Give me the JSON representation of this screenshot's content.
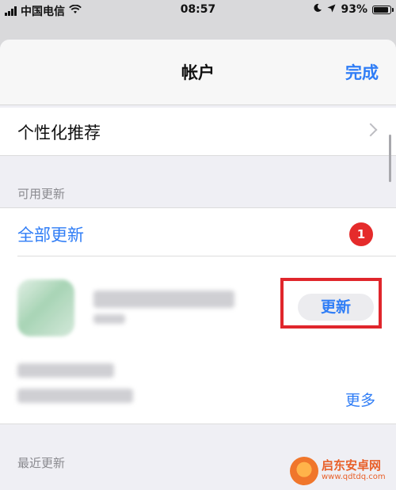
{
  "status_bar": {
    "carrier": "中国电信",
    "time": "08:57",
    "battery": "93%",
    "battery_level": 0.93
  },
  "nav": {
    "title": "帐户",
    "done_label": "完成"
  },
  "personalization": {
    "label": "个性化推荐"
  },
  "available_updates": {
    "section_title": "可用更新",
    "update_all_label": "全部更新",
    "badge_count": "1",
    "app": {
      "update_button_label": "更新",
      "more_label": "更多"
    }
  },
  "recent_updates": {
    "section_title": "最近更新"
  },
  "watermark": {
    "title": "启东安卓网",
    "url": "www.qdtdq.com"
  },
  "colors": {
    "accent": "#2f7df6",
    "badge": "#e52b2b",
    "highlight": "#e0262c"
  }
}
